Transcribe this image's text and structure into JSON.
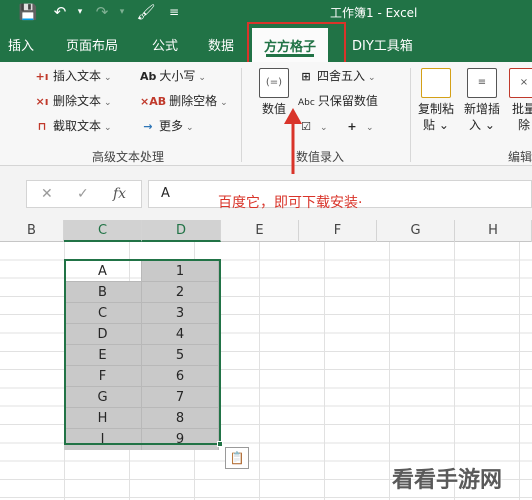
{
  "window": {
    "title": "工作簿1 - Excel"
  },
  "quick_access": {
    "save_icon": "save-icon",
    "undo_icon": "undo-icon",
    "redo_icon": "redo-icon",
    "format_painter_icon": "format-painter-icon",
    "customize_icon": "customize-icon"
  },
  "tabs": [
    {
      "label": "插入"
    },
    {
      "label": "页面布局"
    },
    {
      "label": "公式"
    },
    {
      "label": "数据"
    },
    {
      "label": "方方格子",
      "active": true
    },
    {
      "label": "DIY工具箱"
    }
  ],
  "ribbon": {
    "advanced_text_group": {
      "label": "高级文本处理",
      "items": [
        {
          "icon": "insert-text-icon",
          "label": "插入文本"
        },
        {
          "icon": "delete-text-icon",
          "label": "删除文本"
        },
        {
          "icon": "extract-text-icon",
          "label": "截取文本"
        },
        {
          "icon": "case-icon",
          "label": "大小写"
        },
        {
          "icon": "delete-space-icon",
          "label": "删除空格"
        },
        {
          "icon": "more-icon",
          "label": "更多"
        }
      ]
    },
    "numeric_group": {
      "label": "数值录入",
      "big_button_label": "数值",
      "items": [
        {
          "icon": "round-icon",
          "label": "四舍五入"
        },
        {
          "icon": "keep-values-icon",
          "label": "只保留数值"
        }
      ]
    },
    "right_buttons": [
      {
        "label": "复制粘贴",
        "line1": "复制粘",
        "line2": "贴"
      },
      {
        "label": "新增插入",
        "line1": "新增插",
        "line2": "入"
      },
      {
        "label": "批量删除",
        "line1": "批量",
        "line2": "除"
      }
    ],
    "edit_group_label": "编辑"
  },
  "formula_bar": {
    "value": "A"
  },
  "annotation": "百度它，即可下载安装·",
  "columns": [
    "B",
    "C",
    "D",
    "E",
    "F",
    "G",
    "H"
  ],
  "selected_columns": [
    "C",
    "D"
  ],
  "table": {
    "col_c": [
      "A",
      "B",
      "C",
      "D",
      "E",
      "F",
      "G",
      "H",
      "I"
    ],
    "col_d": [
      "1",
      "2",
      "3",
      "4",
      "5",
      "6",
      "7",
      "8",
      "9"
    ]
  },
  "watermark": "看看手游网",
  "colors": {
    "excel_green": "#217346",
    "highlight_red": "#d9342a",
    "selection_fill": "#c9c9c9"
  }
}
